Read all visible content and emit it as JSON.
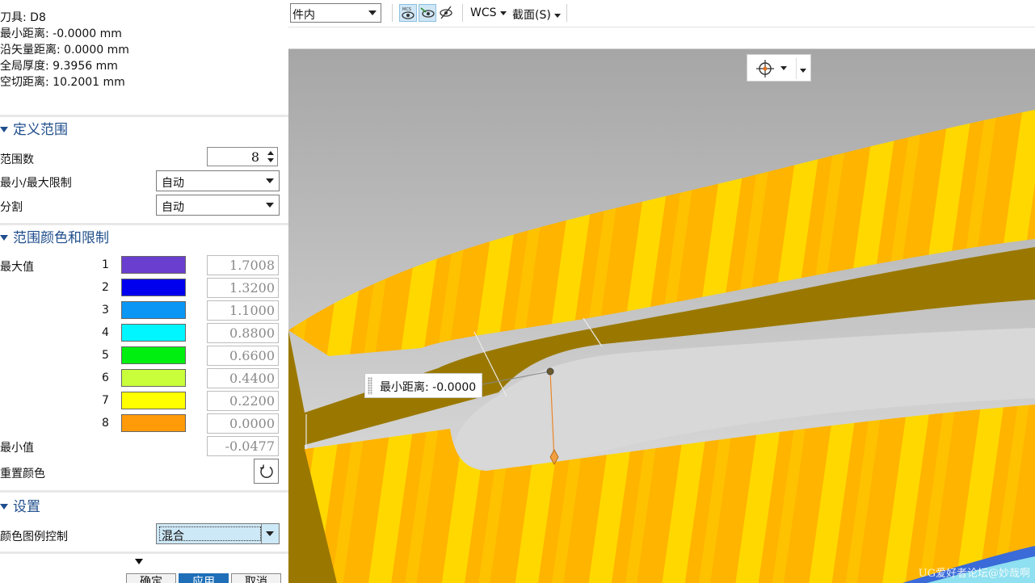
{
  "panel": {
    "info": {
      "tool": "刀具: D8",
      "min_distance": "最小距离: -0.0000 mm",
      "vector_distance": "沿矢量距离: 0.0000 mm",
      "global_thickness": "全局厚度: 9.3956 mm",
      "air_cut_distance": "空切距离: 10.2001 mm"
    },
    "define_range": {
      "title": "定义范围",
      "range_count_label": "范围数",
      "range_count_value": "8",
      "minmax_label": "最小/最大限制",
      "minmax_value": "自动",
      "split_label": "分割",
      "split_value": "自动"
    },
    "range_colors": {
      "title": "范围颜色和限制",
      "max_label": "最大值",
      "min_label": "最小值",
      "min_value": "-0.0477",
      "reset_label": "重置颜色",
      "rows": [
        {
          "index": "1",
          "color": "#6a3fd0",
          "value": "1.7008"
        },
        {
          "index": "2",
          "color": "#0000ee",
          "value": "1.3200"
        },
        {
          "index": "3",
          "color": "#0a96f4",
          "value": "1.1000"
        },
        {
          "index": "4",
          "color": "#00f6ff",
          "value": "0.8800"
        },
        {
          "index": "5",
          "color": "#00ee10",
          "value": "0.6600"
        },
        {
          "index": "6",
          "color": "#c8ff3a",
          "value": "0.4400"
        },
        {
          "index": "7",
          "color": "#ffff00",
          "value": "0.2200"
        },
        {
          "index": "8",
          "color": "#ff9a08",
          "value": "0.0000"
        }
      ]
    },
    "settings": {
      "title": "设置",
      "legend_label": "颜色图例控制",
      "legend_value": "混合"
    },
    "buttons": {
      "ok": "确定",
      "apply": "应用",
      "cancel": "取消"
    }
  },
  "toolbar": {
    "filter_value": "件内",
    "wcs_label": "WCS",
    "section_label": "截面(S)"
  },
  "viewport": {
    "tooltip": "最小距离: -0.0000",
    "watermark": "UG爱好者论坛@妙哉啊",
    "colors": {
      "background_top": "#a6a6a6",
      "background_bottom": "#e4e4e4",
      "part_yellow": "#ffd200",
      "part_orange": "#ffb000",
      "wall": "#9a7800"
    }
  }
}
